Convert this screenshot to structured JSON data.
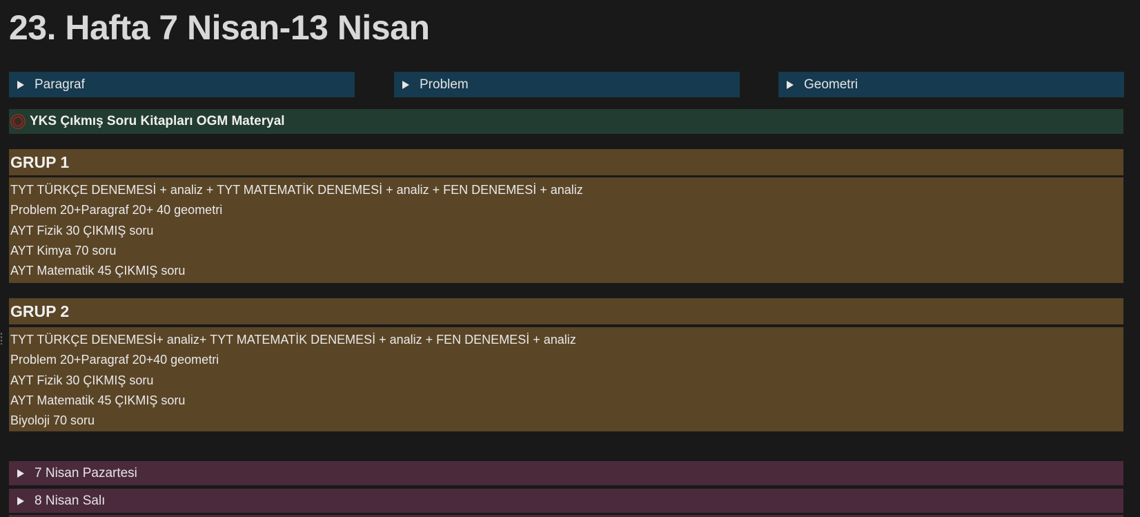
{
  "page": {
    "title": "23. Hafta 7 Nisan-13 Nisan"
  },
  "toggles": [
    {
      "label": "Paragraf"
    },
    {
      "label": "Problem"
    },
    {
      "label": "Geometri"
    }
  ],
  "callout": {
    "icon": "globe-icon",
    "text": "YKS Çıkmış Soru Kitapları OGM Materyal"
  },
  "groups": [
    {
      "title": "GRUP 1",
      "lines": [
        "TYT TÜRKÇE DENEMESİ + analiz + TYT MATEMATİK DENEMESİ + analiz + FEN DENEMESİ + analiz",
        "Problem 20+Paragraf 20+ 40 geometri",
        "AYT Fizik 30 ÇIKMIŞ soru",
        "AYT Kimya 70 soru",
        "AYT Matematik 45 ÇIKMIŞ soru"
      ]
    },
    {
      "title": "GRUP 2",
      "lines": [
        "TYT TÜRKÇE DENEMESİ+ analiz+ TYT MATEMATİK DENEMESİ + analiz + FEN DENEMESİ + analiz",
        "Problem 20+Paragraf 20+40 geometri",
        "AYT Fizik 30 ÇIKMIŞ soru",
        "AYT Matematik 45 ÇIKMIŞ soru",
        "Biyoloji 70 soru"
      ]
    }
  ],
  "days": [
    {
      "label": "7 Nisan Pazartesi"
    },
    {
      "label": "8 Nisan Salı"
    }
  ],
  "colors": {
    "background": "#191919",
    "toggle_blue": "#163a4f",
    "callout_green": "#223c32",
    "group_brown": "#5a4527",
    "day_purple": "#4b2a3c"
  }
}
